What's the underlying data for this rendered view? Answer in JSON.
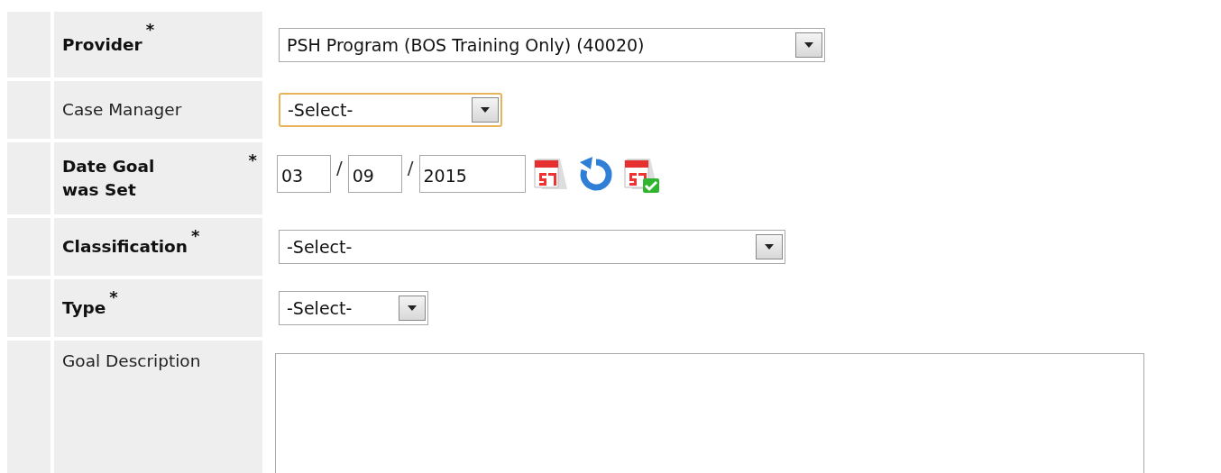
{
  "fields": [
    {
      "kind": "select",
      "label": "Provider",
      "required": true,
      "marker": "*",
      "value": "PSH Program (BOS Training Only) (40020)",
      "focused": false
    },
    {
      "kind": "select",
      "label": "Case Manager",
      "required": false,
      "value": "-Select-",
      "focused": true
    },
    {
      "kind": "date",
      "label": "Date Goal was Set",
      "required": true,
      "marker": "*",
      "month": "03",
      "day": "09",
      "year": "2015",
      "separators": [
        "/",
        "/"
      ]
    },
    {
      "kind": "select",
      "label": "Classification",
      "required": true,
      "marker": "*",
      "value": "-Select-",
      "focused": false
    },
    {
      "kind": "select",
      "label": "Type",
      "required": true,
      "marker": "*",
      "value": "-Select-",
      "focused": false
    },
    {
      "kind": "textarea",
      "label": "Goal Description",
      "required": false
    }
  ]
}
